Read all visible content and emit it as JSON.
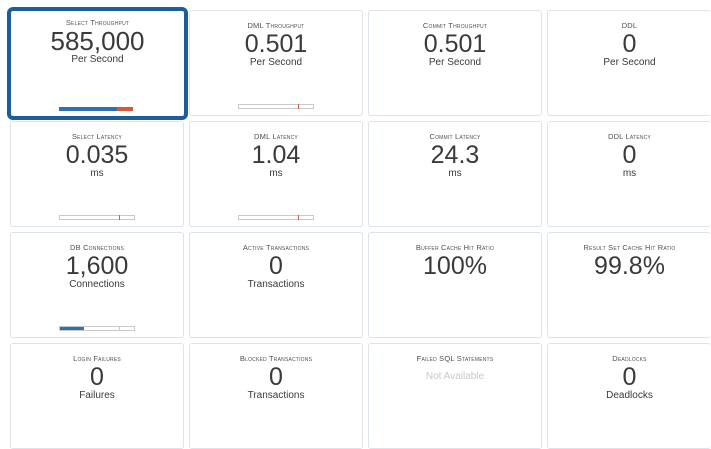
{
  "tiles": [
    {
      "title": "Select Throughput",
      "value": "585,000",
      "unit": "Per Second"
    },
    {
      "title": "DML Throughput",
      "value": "0.501",
      "unit": "Per Second"
    },
    {
      "title": "Commit Throughput",
      "value": "0.501",
      "unit": "Per Second"
    },
    {
      "title": "DDL",
      "value": "0",
      "unit": "Per Second"
    },
    {
      "title": "Select Latency",
      "value": "0.035",
      "unit": "ms"
    },
    {
      "title": "DML Latency",
      "value": "1.04",
      "unit": "ms"
    },
    {
      "title": "Commit Latency",
      "value": "24.3",
      "unit": "ms"
    },
    {
      "title": "DDL Latency",
      "value": "0",
      "unit": "ms"
    },
    {
      "title": "DB Connections",
      "value": "1,600",
      "unit": "Connections"
    },
    {
      "title": "Active Transactions",
      "value": "0",
      "unit": "Transactions"
    },
    {
      "title": "Buffer Cache Hit Ratio",
      "value": "100%",
      "unit": ""
    },
    {
      "title": "Result Set Cache Hit Ratio",
      "value": "99.8%",
      "unit": ""
    },
    {
      "title": "Login Failures",
      "value": "0",
      "unit": "Failures"
    },
    {
      "title": "Blocked Transactions",
      "value": "0",
      "unit": "Transactions"
    },
    {
      "title": "Failed SQL Statements",
      "value": "Not Available",
      "unit": ""
    },
    {
      "title": "Deadlocks",
      "value": "0",
      "unit": "Deadlocks"
    }
  ],
  "gauges": {
    "select_throughput": {
      "fill": 0.78,
      "tick": 0.78,
      "fill_color": "#2f6fb5",
      "tick_color": "#d65a3a"
    },
    "dml_throughput": {
      "fill": 0.0,
      "tick": 0.8
    },
    "select_latency": {
      "fill": 0.0,
      "tick": 0.8
    },
    "dml_latency": {
      "fill": 0.0,
      "tick": 0.8
    },
    "db_connections": {
      "fill": 0.33,
      "tick": 0.8,
      "fill_color": "#2f6fb5"
    }
  },
  "colors": {
    "selected_border": "#1a5f9c",
    "accent_blue": "#2f6fb5",
    "accent_red": "#d65a3a",
    "not_available": "#c8c8c8"
  }
}
